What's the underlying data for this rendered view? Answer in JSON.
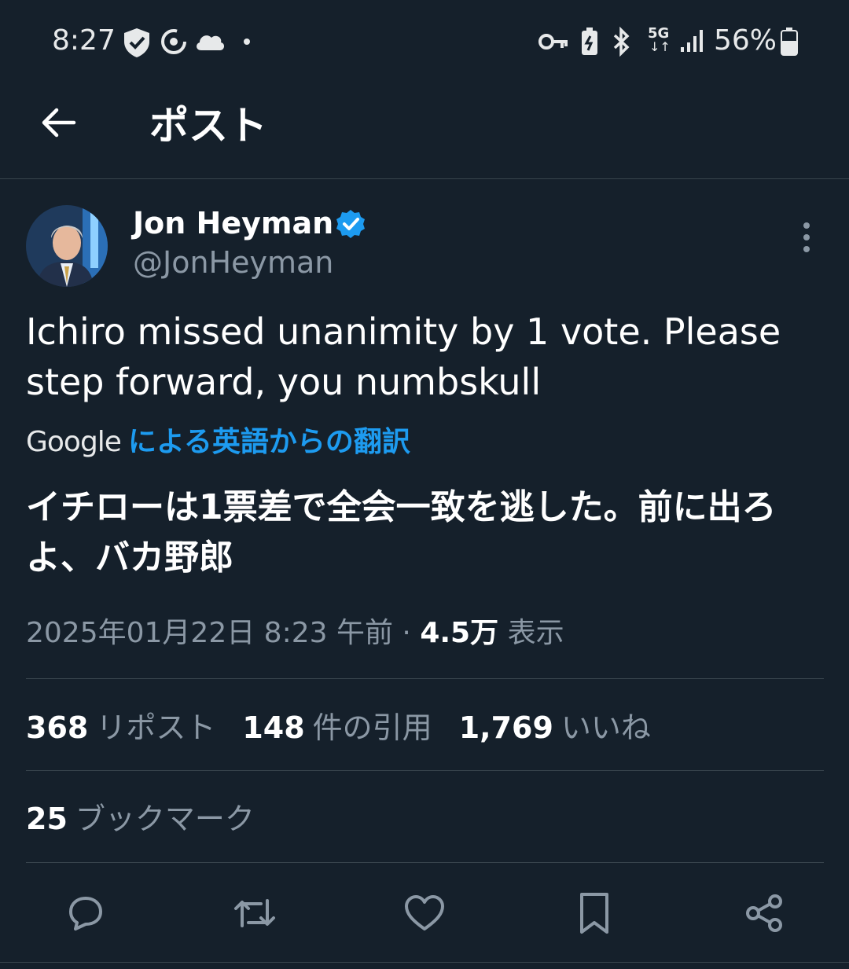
{
  "status_bar": {
    "time": "8:27",
    "battery_percent": "56%",
    "network": "5G",
    "icons": [
      "shield-check-icon",
      "sync-icon",
      "cloud-icon",
      "dot-icon",
      "key-icon",
      "battery-saver-icon",
      "bluetooth-icon",
      "5g-icon",
      "signal-icon",
      "battery-icon"
    ]
  },
  "header": {
    "title": "ポスト",
    "back_icon": "arrow-left-icon"
  },
  "post": {
    "author": {
      "name": "Jon Heyman",
      "handle": "@JonHeyman",
      "verified": true
    },
    "text": "Ichiro missed unanimity by 1 vote. Please step forward, you numbskull",
    "translation": {
      "provider": "Google",
      "link": "による英語からの翻訳",
      "text": "イチローは1票差で全会一致を逃した。前に出ろよ、バカ野郎"
    },
    "meta": {
      "datetime": "2025年01月22日 8:23 午前",
      "separator": "·",
      "views_count": "4.5万",
      "views_label": "表示"
    },
    "stats": {
      "reposts": {
        "count": "368",
        "label": "リポスト"
      },
      "quotes": {
        "count": "148",
        "label": "件の引用"
      },
      "likes": {
        "count": "1,769",
        "label": "いいね"
      },
      "bookmarks": {
        "count": "25",
        "label": "ブックマーク"
      }
    },
    "actions": [
      "reply-icon",
      "repost-icon",
      "like-icon",
      "bookmark-icon",
      "share-icon"
    ]
  },
  "colors": {
    "background": "#15202b",
    "accent": "#1d9bf0",
    "muted": "#8b98a5",
    "divider": "#38444d"
  }
}
